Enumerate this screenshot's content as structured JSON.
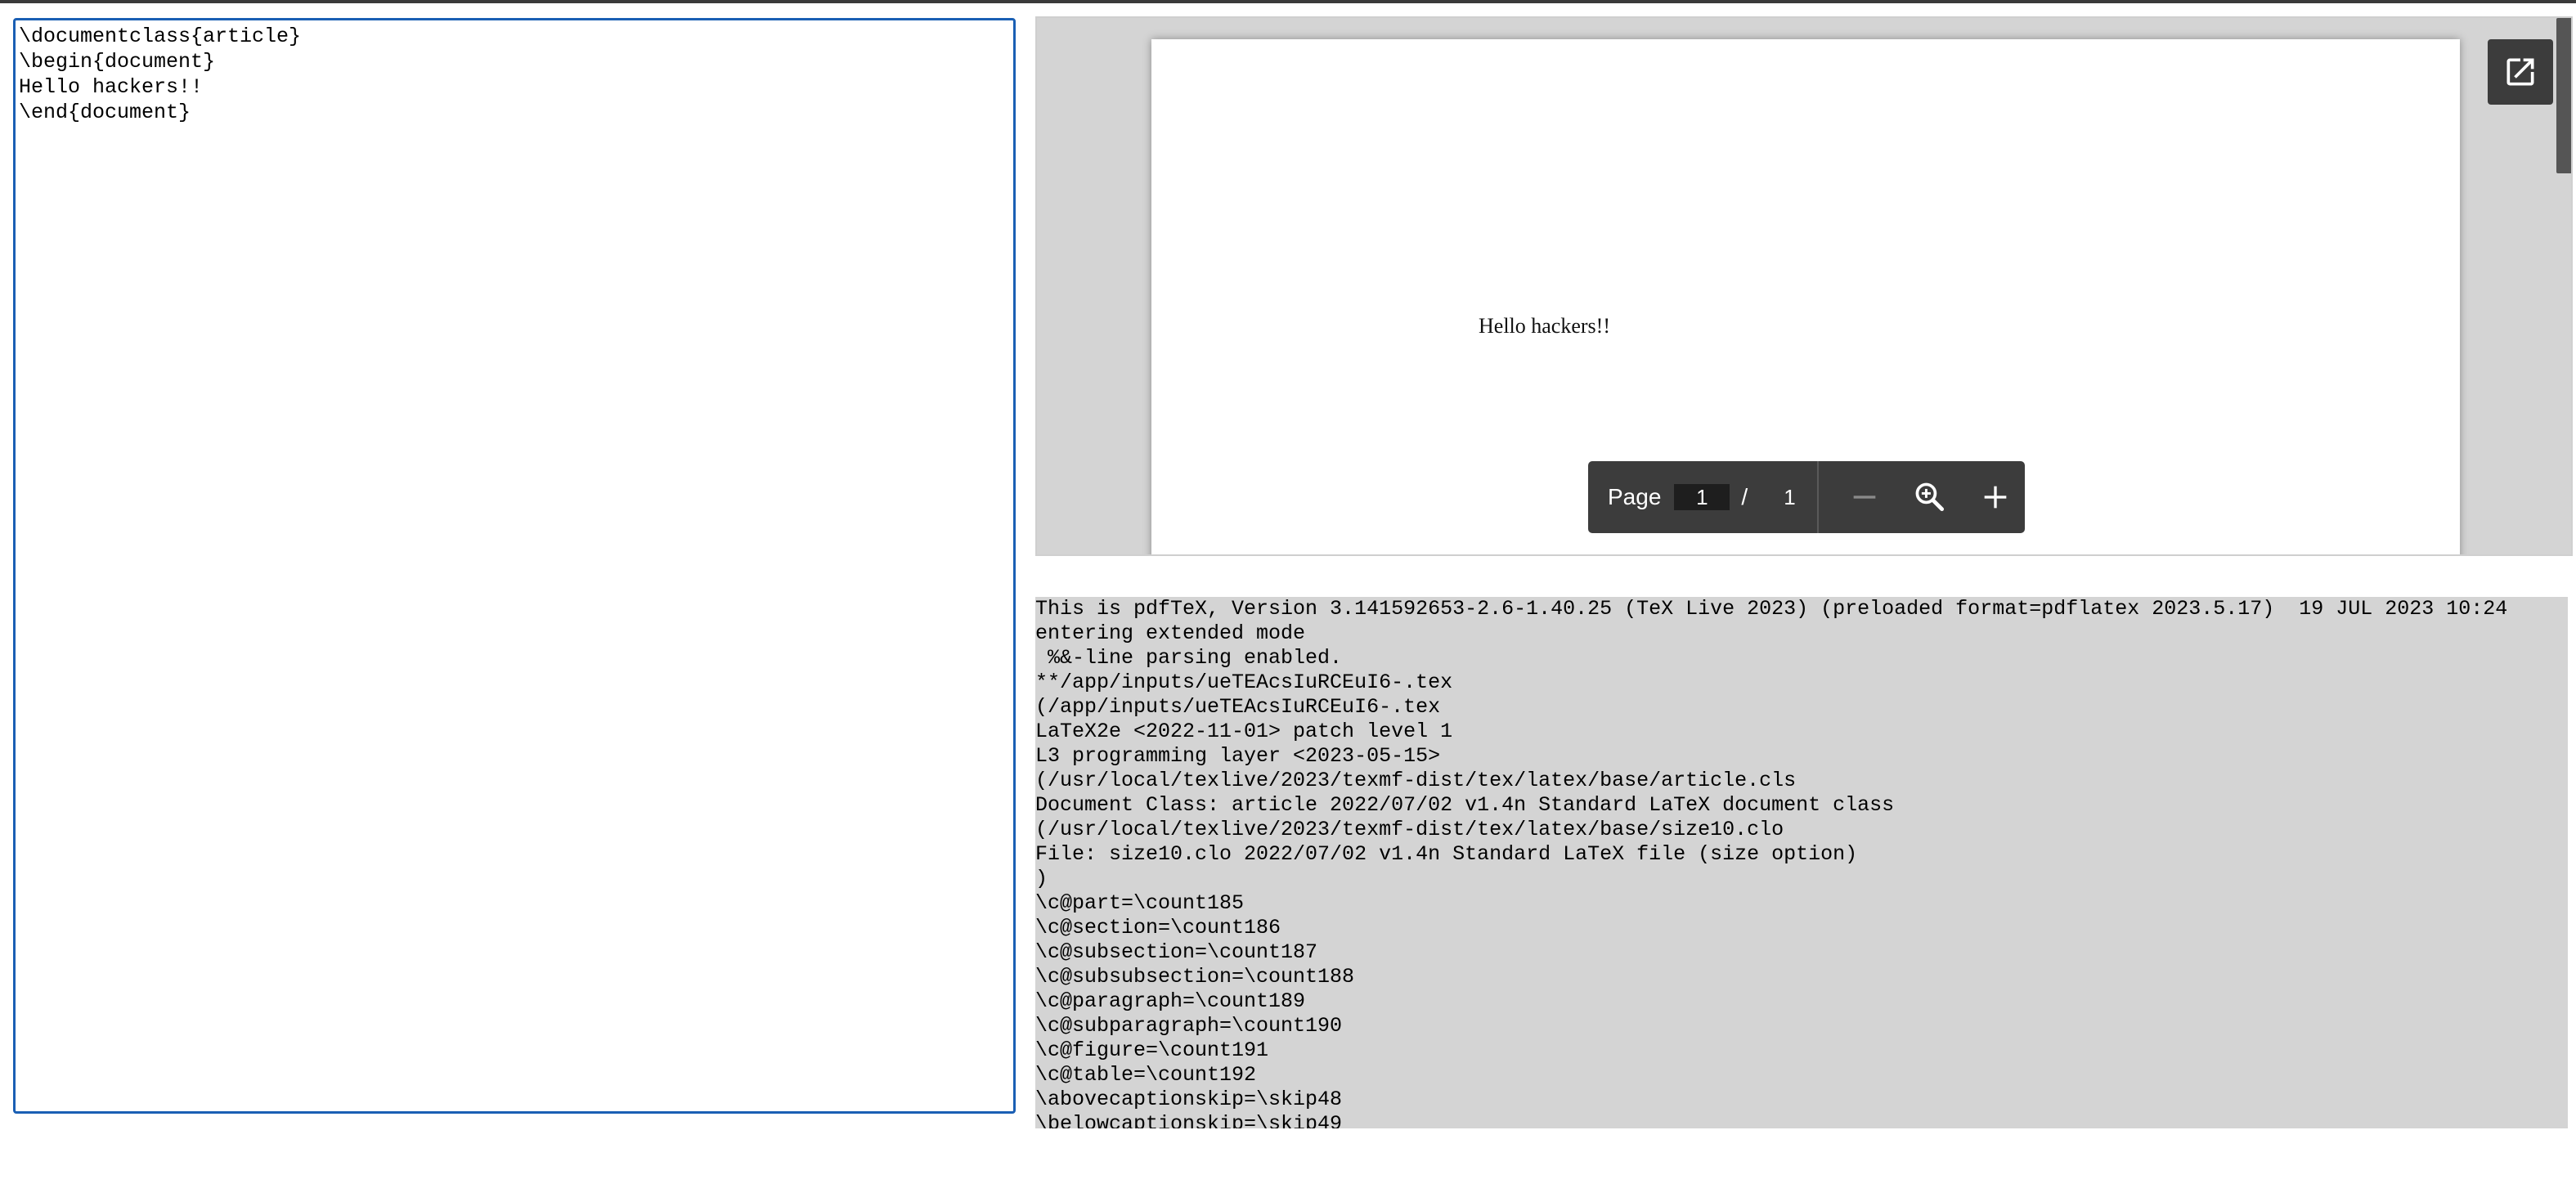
{
  "editor": {
    "content": "\\documentclass{article}\n\\begin{document}\nHello hackers!!\n\\end{document}"
  },
  "viewer": {
    "page_text": "Hello hackers!!",
    "open_external_icon": "open-in-new-icon",
    "toolbar": {
      "page_label": "Page",
      "current_page": "1",
      "separator": "/",
      "total_pages": "1",
      "zoom_out_icon": "minus-icon",
      "zoom_icon": "magnifier-zoom-icon",
      "zoom_in_icon": "plus-icon"
    }
  },
  "log": {
    "lines": [
      "This is pdfTeX, Version 3.141592653-2.6-1.40.25 (TeX Live 2023) (preloaded format=pdflatex 2023.5.17)  19 JUL 2023 10:24",
      "entering extended mode",
      " %&-line parsing enabled.",
      "**/app/inputs/ueTEAcsIuRCEuI6-.tex",
      "(/app/inputs/ueTEAcsIuRCEuI6-.tex",
      "LaTeX2e <2022-11-01> patch level 1",
      "L3 programming layer <2023-05-15>",
      "(/usr/local/texlive/2023/texmf-dist/tex/latex/base/article.cls",
      "Document Class: article 2022/07/02 v1.4n Standard LaTeX document class",
      "(/usr/local/texlive/2023/texmf-dist/tex/latex/base/size10.clo",
      "File: size10.clo 2022/07/02 v1.4n Standard LaTeX file (size option)",
      ")",
      "\\c@part=\\count185",
      "\\c@section=\\count186",
      "\\c@subsection=\\count187",
      "\\c@subsubsection=\\count188",
      "\\c@paragraph=\\count189",
      "\\c@subparagraph=\\count190",
      "\\c@figure=\\count191",
      "\\c@table=\\count192",
      "\\abovecaptionskip=\\skip48",
      "\\belowcaptionskip=\\skip49"
    ]
  }
}
